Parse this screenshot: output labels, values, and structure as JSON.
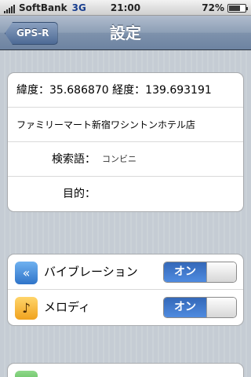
{
  "status": {
    "carrier": "SoftBank",
    "network": "3G",
    "time": "21:00",
    "battery": "72%",
    "battery_level": 0.72
  },
  "nav": {
    "back_label": "GPS-R",
    "title": "設定"
  },
  "info": {
    "coords": "緯度：35.686870 経度：139.693191",
    "place": "ファミリーマート新宿ワシントンホテル店",
    "keyword_label": "検索語：",
    "keyword_value": "コンビニ",
    "purpose_label": "目的："
  },
  "settings": {
    "vibration": {
      "label": "バイブレーション",
      "state": "オン",
      "icon": "vibration-icon",
      "icon_color": "#3c82d8"
    },
    "melody": {
      "label": "メロディ",
      "state": "オン",
      "icon": "music-note-icon",
      "icon_color": "#f5b030"
    }
  }
}
